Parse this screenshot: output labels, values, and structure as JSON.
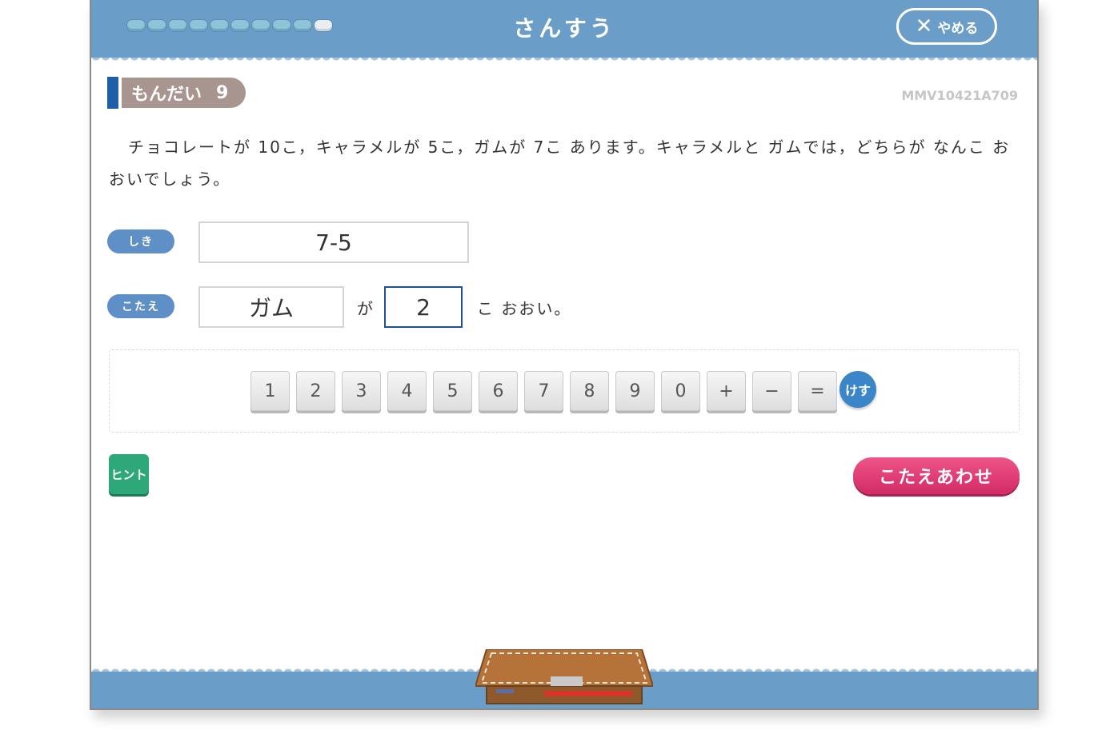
{
  "header": {
    "title": "さんすう",
    "quit_label": "やめる",
    "progress_total": 10,
    "progress_current": 10
  },
  "question": {
    "label": "もんだい",
    "number": "9",
    "id": "MMV10421A709",
    "text": "チョコレートが 10こ，キャラメルが 5こ，ガムが 7こ あります。キャラメルと ガムでは，どちらが なんこ おおいでしょう。"
  },
  "formula": {
    "tag": "しき",
    "value": "7-5"
  },
  "answer": {
    "tag": "こたえ",
    "item_value": "ガム",
    "particle": "が",
    "count_value": "2",
    "suffix": "こ おおい。"
  },
  "keypad": {
    "keys": [
      "1",
      "2",
      "3",
      "4",
      "5",
      "6",
      "7",
      "8",
      "9",
      "0",
      "+",
      "−",
      "="
    ],
    "clear_label": "けす"
  },
  "buttons": {
    "hint_label": "ヒント",
    "check_label": "こたえあわせ"
  },
  "colors": {
    "header_blue": "#6b9dc9",
    "label_blue": "#5f8fc7",
    "active_border": "#1e4f9a",
    "hint_green": "#2ea879",
    "check_pink": "#d22a66",
    "question_pill": "#a99590"
  }
}
